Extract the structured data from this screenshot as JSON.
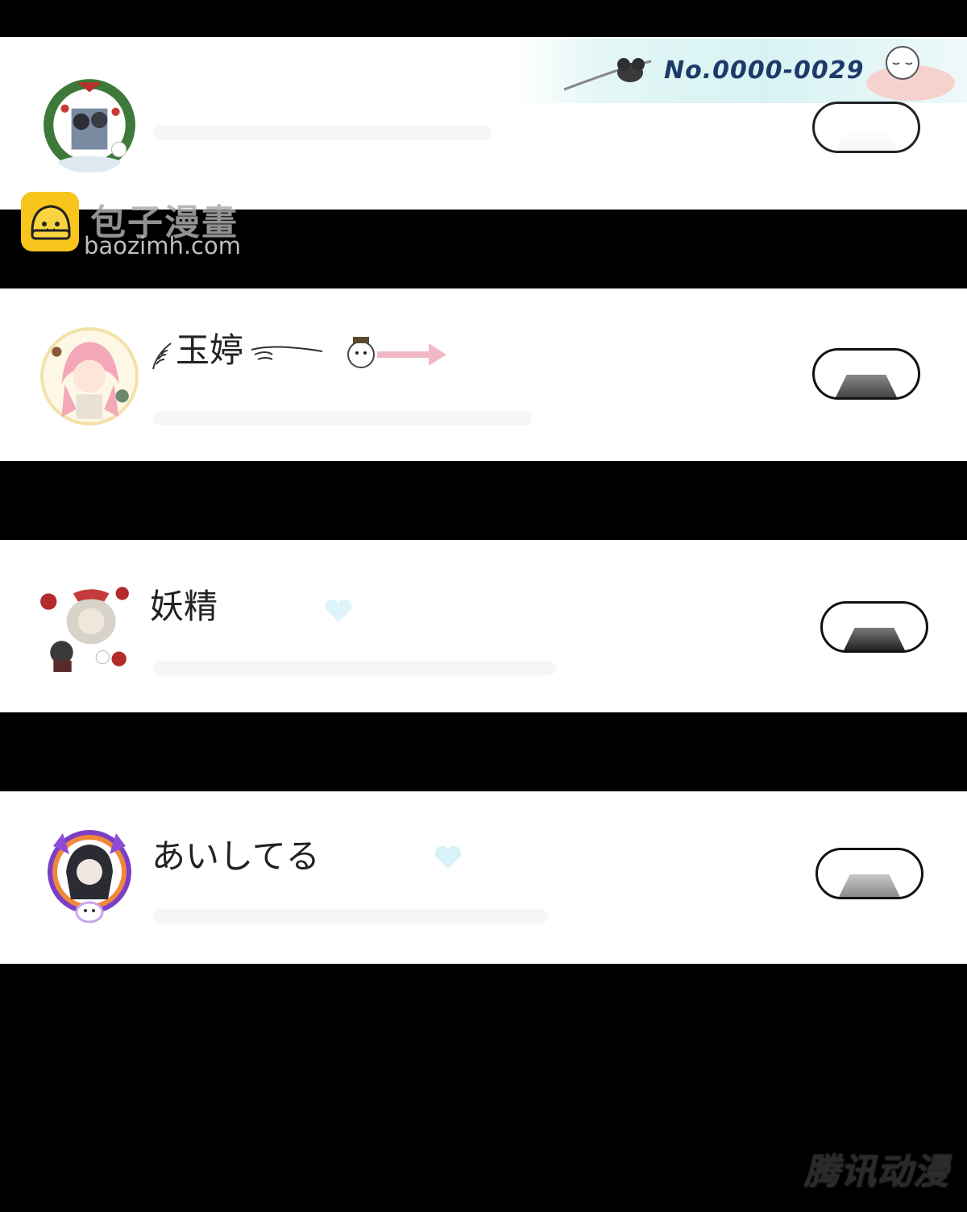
{
  "banner": {
    "label": "No.0000-0029",
    "icon": "ink-bird-branch-icon"
  },
  "site_logo": {
    "title": "包子漫畫",
    "url": "baozimh.com",
    "icon": "bun-face-icon",
    "brand_color": "#f7c51c"
  },
  "users": [
    {
      "name": "",
      "avatar": "christmas-wreath-avatar-icon",
      "action": "pill-toggle-icon"
    },
    {
      "name": "玉婷",
      "avatar": "pink-hair-girl-avatar-icon",
      "action": "pill-toggle-icon"
    },
    {
      "name": "妖精",
      "avatar": "rose-couple-avatar-icon",
      "action": "pill-toggle-icon"
    },
    {
      "name": "あいしてる",
      "avatar": "purple-frame-avatar-icon",
      "action": "pill-toggle-icon"
    }
  ],
  "watermark": {
    "text": "腾讯动漫"
  }
}
